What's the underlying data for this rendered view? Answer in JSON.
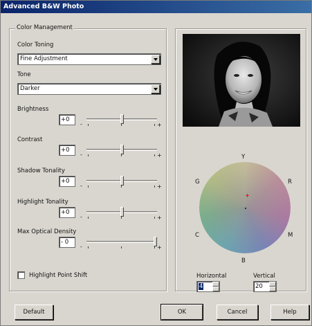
{
  "window": {
    "title": "Advanced B&W Photo"
  },
  "color_management": {
    "group_title": "Color Management",
    "color_toning_label": "Color Toning",
    "color_toning_value": "Fine Adjustment",
    "tone_label": "Tone",
    "tone_value": "Darker",
    "sliders": [
      {
        "label": "Brightness",
        "value": "+0",
        "level": 0.5
      },
      {
        "label": "Contrast",
        "value": "+0",
        "level": 0.5
      },
      {
        "label": "Shadow Tonality",
        "value": "+0",
        "level": 0.5
      },
      {
        "label": "Highlight Tonality",
        "value": "+0",
        "level": 0.5
      },
      {
        "label": "Max Optical Density",
        "value": "- 0",
        "level": 1.0
      }
    ],
    "minus": "-",
    "plus": "+",
    "highlight_point_shift_label": "Highlight Point Shift",
    "highlight_point_shift_checked": false
  },
  "color_wheel": {
    "labels": {
      "top": "Y",
      "right_top": "R",
      "right_bottom": "M",
      "bottom": "B",
      "left_bottom": "C",
      "left_top": "G"
    },
    "horizontal_label": "Horizontal",
    "horizontal_value": "4",
    "vertical_label": "Vertical",
    "vertical_value": "20"
  },
  "buttons": {
    "default": "Default",
    "ok": "OK",
    "cancel": "Cancel",
    "help": "Help"
  },
  "colors": {
    "title_bar": "#0a246a",
    "dialog_bg": "#d9d6cf",
    "marker": "#d02020"
  }
}
